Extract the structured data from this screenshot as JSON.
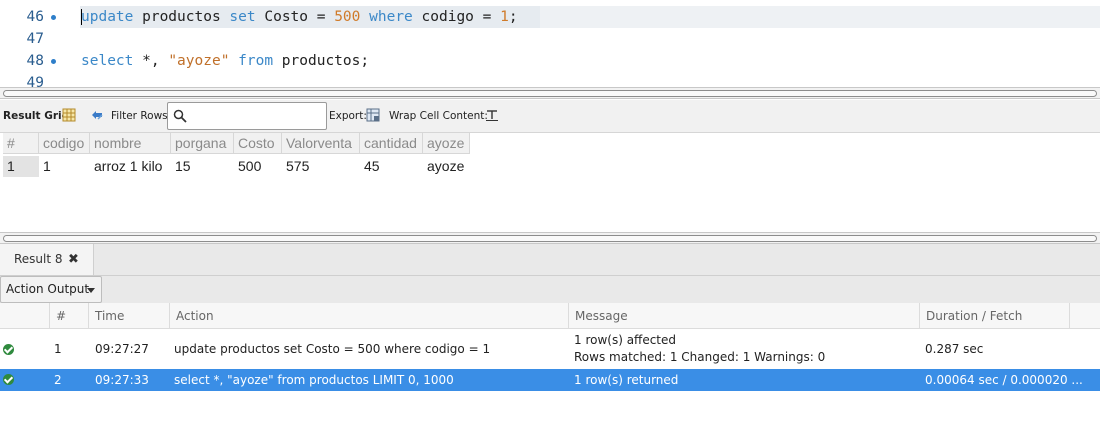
{
  "editor": {
    "lines": [
      {
        "num": "46",
        "has_dot": true
      },
      {
        "num": "47",
        "has_dot": false
      },
      {
        "num": "48",
        "has_dot": true
      },
      {
        "num": "49",
        "has_dot": false
      }
    ],
    "line46": {
      "kw1": "update",
      "t1": " productos ",
      "kw2": "set",
      "t2": " Costo = ",
      "n1": "500",
      "t3": " ",
      "kw3": "where",
      "t4": " codigo = ",
      "n2": "1",
      "t5": ";"
    },
    "line48": {
      "kw1": "select",
      "t1": " *, ",
      "s1": "\"ayoze\"",
      "t2": " ",
      "kw2": "from",
      "t3": " productos;"
    }
  },
  "toolbar": {
    "result_grid": "Result Grid",
    "filter_rows": "Filter Rows:",
    "filter_value": "",
    "export": "Export:",
    "wrap_cell": "Wrap Cell Content:"
  },
  "grid": {
    "headers": [
      "#",
      "codigo",
      "nombre",
      "porgana",
      "Costo",
      "Valorventa",
      "cantidad",
      "ayoze"
    ],
    "rows": [
      [
        "1",
        "1",
        "arroz 1 kilo",
        "15",
        "500",
        "575",
        "45",
        "ayoze"
      ]
    ]
  },
  "tabs": {
    "result_tab": "Result 8",
    "close": "✖"
  },
  "action_output": {
    "dropdown_label": "Action Output",
    "headers": [
      "#",
      "Time",
      "Action",
      "Message",
      "Duration / Fetch"
    ],
    "rows": [
      {
        "num": "1",
        "time": "09:27:27",
        "action": "update productos set Costo = 500 where codigo = 1",
        "message1": "1 row(s) affected",
        "message2": "Rows matched: 1  Changed: 1  Warnings: 0",
        "duration": "0.287 sec"
      },
      {
        "num": "2",
        "time": "09:27:33",
        "action": "select *, \"ayoze\" from productos LIMIT 0, 1000",
        "message1": "1 row(s) returned",
        "duration": "0.00064 sec / 0.000020 ..."
      }
    ]
  },
  "colors": {
    "keyword": "#3b88c8",
    "number": "#d07b2a",
    "selection": "#3a8ee6",
    "success": "#2f8a3e"
  }
}
